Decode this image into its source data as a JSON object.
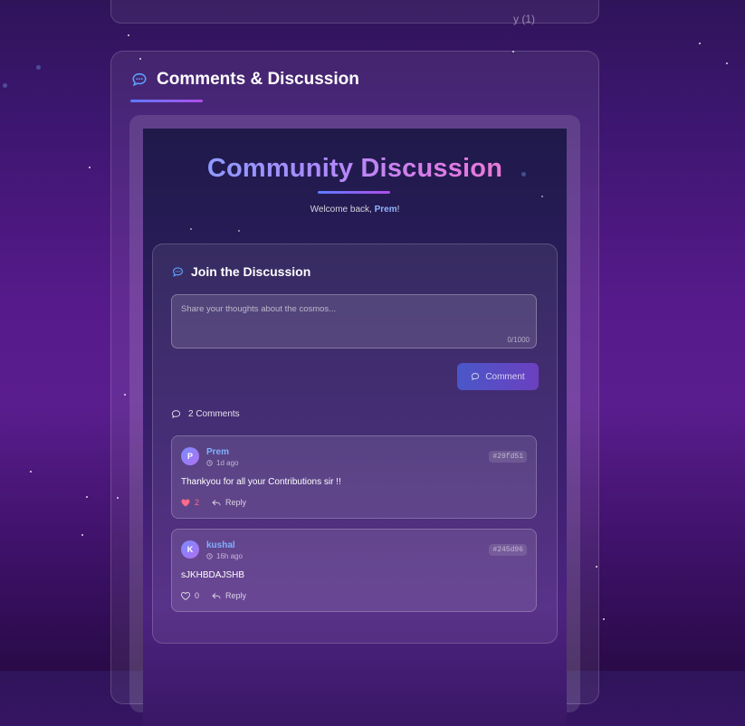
{
  "top_card": {
    "partial_text": "y (1)"
  },
  "section": {
    "title": "Comments & Discussion",
    "icon": "chat-bubble-icon"
  },
  "discussion": {
    "title": "Community Discussion",
    "welcome_prefix": "Welcome back, ",
    "welcome_user": "Prem",
    "welcome_suffix": "!",
    "join_title": "Join the Discussion",
    "textarea_placeholder": "Share your thoughts about the cosmos...",
    "char_count": "0/1000",
    "comment_button": "Comment",
    "comments_count": "2 Comments",
    "comments": [
      {
        "initial": "P",
        "author": "Prem",
        "time": "1d ago",
        "id": "#29fd51",
        "text": "Thankyou for all your Contributions sir !!",
        "likes": "2",
        "liked": true,
        "reply": "Reply"
      },
      {
        "initial": "K",
        "author": "kushal",
        "time": "16h ago",
        "id": "#245d96",
        "text": "sJKHBDAJSHB",
        "likes": "0",
        "liked": false,
        "reply": "Reply"
      }
    ]
  },
  "colors": {
    "accent_blue": "#7fb0ff",
    "accent_purple": "#b04ee8",
    "like_red": "#ff6b8a"
  }
}
